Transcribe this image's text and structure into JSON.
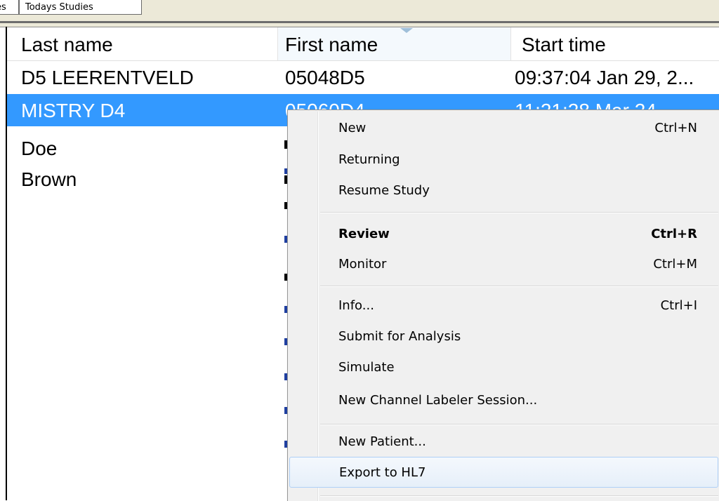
{
  "tabs": [
    {
      "label": "es"
    },
    {
      "label": "Todays Studies"
    }
  ],
  "table": {
    "columns": [
      "Last name",
      "First name",
      "Start time"
    ],
    "rows": [
      {
        "last": "D5 LEERENTVELD",
        "first": "05048D5",
        "start": "09:37:04 Jan 29, 2..."
      },
      {
        "last": "MISTRY D4",
        "first": "05060D4",
        "start": "11:21:28 Mar 24..."
      },
      {
        "last": "Doe",
        "first": "",
        "start": ""
      },
      {
        "last": "Brown",
        "first": "",
        "start": ""
      }
    ]
  },
  "context_menu": {
    "items": [
      {
        "label": "New",
        "shortcut": "Ctrl+N"
      },
      {
        "label": "Returning",
        "shortcut": ""
      },
      {
        "label": "Resume Study",
        "shortcut": ""
      },
      {
        "label": "Review",
        "shortcut": "Ctrl+R"
      },
      {
        "label": "Monitor",
        "shortcut": "Ctrl+M"
      },
      {
        "label": "Info...",
        "shortcut": "Ctrl+I"
      },
      {
        "label": "Submit for Analysis",
        "shortcut": ""
      },
      {
        "label": "Simulate",
        "shortcut": ""
      },
      {
        "label": "New Channel Labeler Session...",
        "shortcut": ""
      },
      {
        "label": "New Patient...",
        "shortcut": ""
      },
      {
        "label": "Export to HL7",
        "shortcut": ""
      }
    ]
  },
  "colors": {
    "selection": "#3399ff",
    "menu_bg": "#f0f0f0",
    "menu_hover_border": "#aecff7"
  }
}
